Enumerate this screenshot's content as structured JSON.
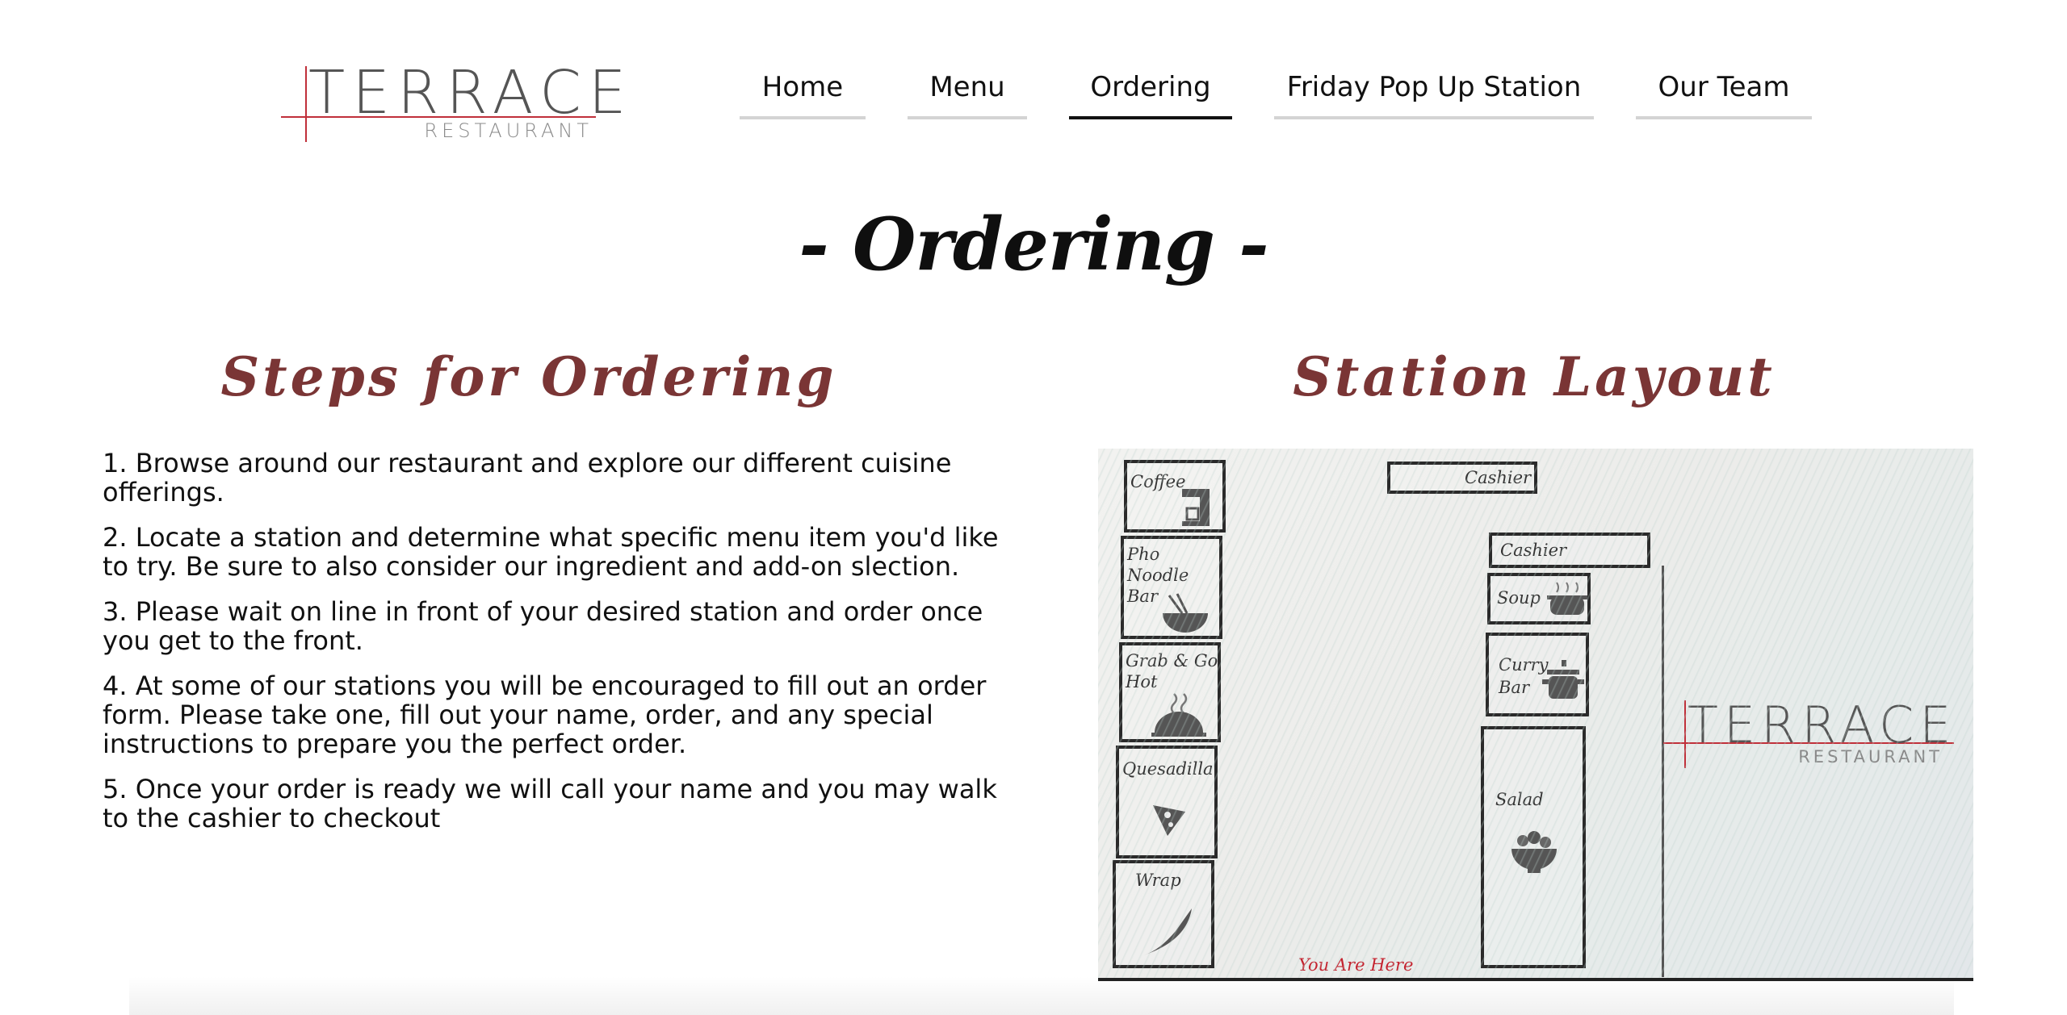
{
  "logo": {
    "word": "TERRACE",
    "sub": "RESTAURANT"
  },
  "nav": {
    "items": [
      {
        "label": "Home",
        "active": false
      },
      {
        "label": "Menu",
        "active": false
      },
      {
        "label": "Ordering",
        "active": true
      },
      {
        "label": "Friday Pop Up Station",
        "active": false
      },
      {
        "label": "Our Team",
        "active": false
      }
    ]
  },
  "page_title": "- Ordering -",
  "steps_section": {
    "title": "Steps for Ordering",
    "steps": [
      "1. Browse around our restaurant and explore our different cuisine offerings.",
      "2. Locate a station and determine what specific menu item you'd like to try. Be sure to also consider our ingredient and add-on slection.",
      "3. Please wait on line in front of your desired station and order once you get to the front.",
      "4. At some of our stations you will be encouraged to fill out an order form. Please take one, fill out your name, order, and any special instructions to prepare you the perfect order.",
      "5. Once your order is ready we will call your name and you may walk to the cashier to checkout"
    ]
  },
  "layout_section": {
    "title": "Station Layout",
    "stations_left": [
      "Coffee",
      "Pho Noodle Bar",
      "Grab & Go Hot",
      "Quesadilla",
      "Wrap"
    ],
    "stations_right": [
      "Cashier",
      "Cashier",
      "Soup",
      "Curry Bar",
      "Salad"
    ],
    "you_are_here": "You Are Here",
    "logo_word": "TERRACE",
    "logo_sub": "RESTAURANT"
  },
  "colors": {
    "accent": "#7a3535",
    "logo_red": "#c0303a",
    "you_are_here": "#c4232f",
    "nav_active": "#111111",
    "nav_inactive": "#d4d4d4"
  }
}
